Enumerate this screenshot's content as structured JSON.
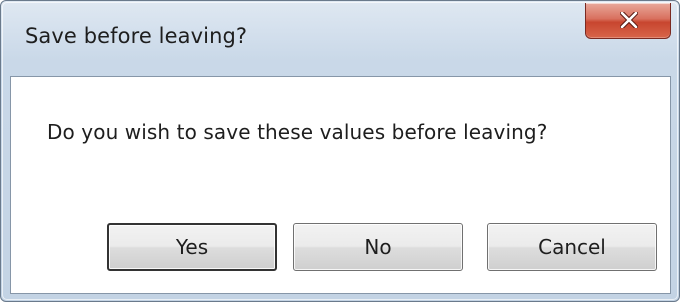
{
  "dialog": {
    "title": "Save before leaving?",
    "message": "Do you wish to save these values before leaving?",
    "buttons": {
      "yes": "Yes",
      "no": "No",
      "cancel": "Cancel"
    },
    "close_icon": "close-x-icon"
  }
}
